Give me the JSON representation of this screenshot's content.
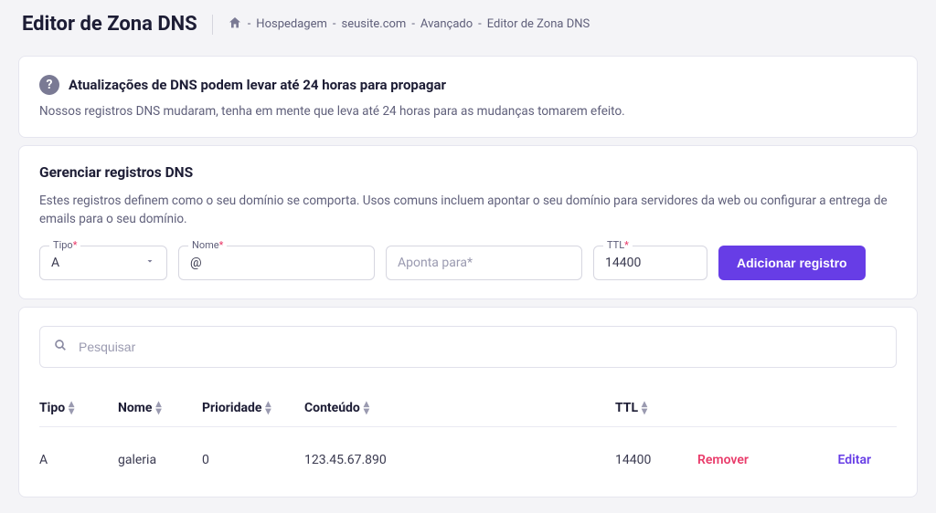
{
  "header": {
    "title": "Editor de Zona DNS",
    "breadcrumb": {
      "sep": " - ",
      "items": [
        "Hospedagem",
        "seusite.com",
        "Avançado",
        "Editor de Zona DNS"
      ]
    }
  },
  "infoCard": {
    "title": "Atualizações de DNS podem levar até 24 horas para propagar",
    "body": "Nossos registros DNS mudaram, tenha em mente que leva até 24 horas para as mudanças tomarem efeito."
  },
  "manageCard": {
    "title": "Gerenciar registros DNS",
    "desc": "Estes registros definem como o seu domínio se comporta. Usos comuns incluem apontar o seu domínio para servidores da web ou configurar a entrega de emails para o seu domínio.",
    "fields": {
      "type": {
        "label": "Tipo",
        "value": "A"
      },
      "name": {
        "label": "Nome",
        "value": "@"
      },
      "points": {
        "placeholder": "Aponta para"
      },
      "ttl": {
        "label": "TTL",
        "value": "14400"
      }
    },
    "addButton": "Adicionar registro"
  },
  "tableCard": {
    "searchPlaceholder": "Pesquisar",
    "headers": {
      "type": "Tipo",
      "name": "Nome",
      "priority": "Prioridade",
      "content": "Conteúdo",
      "ttl": "TTL"
    },
    "rows": [
      {
        "type": "A",
        "name": "galeria",
        "priority": "0",
        "content": "123.45.67.890",
        "ttl": "14400",
        "remove": "Remover",
        "edit": "Editar"
      }
    ]
  }
}
